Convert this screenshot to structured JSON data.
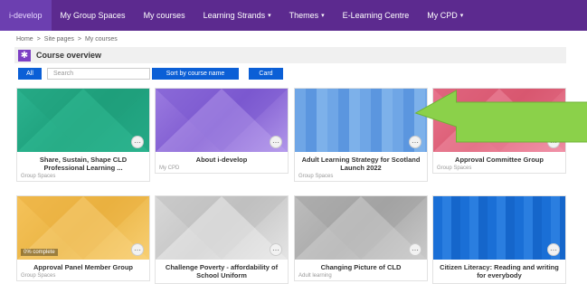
{
  "nav": {
    "items": [
      {
        "label": "i-develop",
        "caret": ""
      },
      {
        "label": "My Group Spaces",
        "caret": ""
      },
      {
        "label": "My courses",
        "caret": ""
      },
      {
        "label": "Learning Strands",
        "caret": "▾"
      },
      {
        "label": "Themes",
        "caret": "▾"
      },
      {
        "label": "E-Learning Centre",
        "caret": ""
      },
      {
        "label": "My CPD",
        "caret": "▾"
      }
    ]
  },
  "breadcrumb": [
    "Home",
    ">",
    "Site pages",
    ">",
    "My courses"
  ],
  "overview": {
    "title": "Course overview",
    "icon": "✱"
  },
  "filters": {
    "all": "All",
    "search_placeholder": "Search",
    "sort": "Sort by course name",
    "view": "Card"
  },
  "cards": [
    {
      "title": "Share, Sustain, Shape CLD Professional Learning ...",
      "category": "Group Spaces",
      "progress": ""
    },
    {
      "title": "About i-develop",
      "category": "My CPD",
      "progress": ""
    },
    {
      "title": "Adult Learning Strategy for Scotland Launch 2022",
      "category": "Group Spaces",
      "progress": ""
    },
    {
      "title": "Approval Committee Group",
      "category": "Group Spaces",
      "progress": ""
    },
    {
      "title": "Approval Panel Member Group",
      "category": "Group Spaces",
      "progress": "0% complete"
    },
    {
      "title": "Challenge Poverty - affordability of School Uniform",
      "category": "",
      "progress": ""
    },
    {
      "title": "Changing Picture of CLD",
      "category": "Adult learning",
      "progress": ""
    },
    {
      "title": "Citizen Literacy: Reading and writing for everybody",
      "category": "",
      "progress": ""
    }
  ],
  "colors": {
    "nav": "#5c2a8f",
    "accent": "#0b5fd6",
    "callout": "#8bd14a"
  },
  "icons": {
    "more": "more-options-icon",
    "overview": "asterisk-icon"
  }
}
